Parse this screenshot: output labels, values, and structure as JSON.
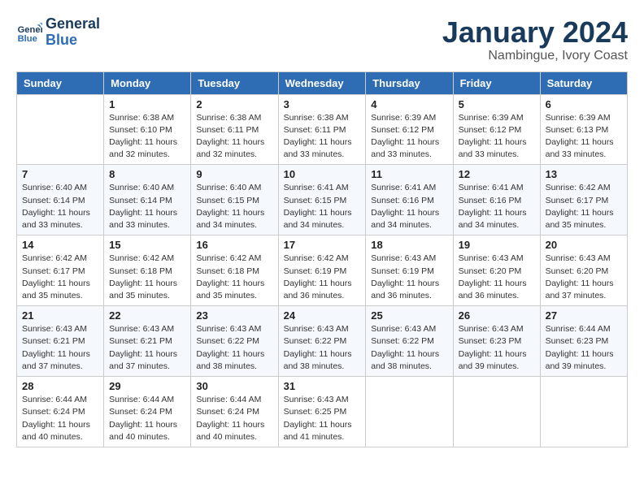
{
  "logo": {
    "line1": "General",
    "line2": "Blue"
  },
  "title": "January 2024",
  "subtitle": "Nambingue, Ivory Coast",
  "days_of_week": [
    "Sunday",
    "Monday",
    "Tuesday",
    "Wednesday",
    "Thursday",
    "Friday",
    "Saturday"
  ],
  "weeks": [
    [
      {
        "day": "",
        "empty": true
      },
      {
        "day": "1",
        "sunrise": "6:38 AM",
        "sunset": "6:10 PM",
        "daylight": "11 hours and 32 minutes."
      },
      {
        "day": "2",
        "sunrise": "6:38 AM",
        "sunset": "6:11 PM",
        "daylight": "11 hours and 32 minutes."
      },
      {
        "day": "3",
        "sunrise": "6:38 AM",
        "sunset": "6:11 PM",
        "daylight": "11 hours and 33 minutes."
      },
      {
        "day": "4",
        "sunrise": "6:39 AM",
        "sunset": "6:12 PM",
        "daylight": "11 hours and 33 minutes."
      },
      {
        "day": "5",
        "sunrise": "6:39 AM",
        "sunset": "6:12 PM",
        "daylight": "11 hours and 33 minutes."
      },
      {
        "day": "6",
        "sunrise": "6:39 AM",
        "sunset": "6:13 PM",
        "daylight": "11 hours and 33 minutes."
      }
    ],
    [
      {
        "day": "7",
        "sunrise": "6:40 AM",
        "sunset": "6:14 PM",
        "daylight": "11 hours and 33 minutes."
      },
      {
        "day": "8",
        "sunrise": "6:40 AM",
        "sunset": "6:14 PM",
        "daylight": "11 hours and 33 minutes."
      },
      {
        "day": "9",
        "sunrise": "6:40 AM",
        "sunset": "6:15 PM",
        "daylight": "11 hours and 34 minutes."
      },
      {
        "day": "10",
        "sunrise": "6:41 AM",
        "sunset": "6:15 PM",
        "daylight": "11 hours and 34 minutes."
      },
      {
        "day": "11",
        "sunrise": "6:41 AM",
        "sunset": "6:16 PM",
        "daylight": "11 hours and 34 minutes."
      },
      {
        "day": "12",
        "sunrise": "6:41 AM",
        "sunset": "6:16 PM",
        "daylight": "11 hours and 34 minutes."
      },
      {
        "day": "13",
        "sunrise": "6:42 AM",
        "sunset": "6:17 PM",
        "daylight": "11 hours and 35 minutes."
      }
    ],
    [
      {
        "day": "14",
        "sunrise": "6:42 AM",
        "sunset": "6:17 PM",
        "daylight": "11 hours and 35 minutes."
      },
      {
        "day": "15",
        "sunrise": "6:42 AM",
        "sunset": "6:18 PM",
        "daylight": "11 hours and 35 minutes."
      },
      {
        "day": "16",
        "sunrise": "6:42 AM",
        "sunset": "6:18 PM",
        "daylight": "11 hours and 35 minutes."
      },
      {
        "day": "17",
        "sunrise": "6:42 AM",
        "sunset": "6:19 PM",
        "daylight": "11 hours and 36 minutes."
      },
      {
        "day": "18",
        "sunrise": "6:43 AM",
        "sunset": "6:19 PM",
        "daylight": "11 hours and 36 minutes."
      },
      {
        "day": "19",
        "sunrise": "6:43 AM",
        "sunset": "6:20 PM",
        "daylight": "11 hours and 36 minutes."
      },
      {
        "day": "20",
        "sunrise": "6:43 AM",
        "sunset": "6:20 PM",
        "daylight": "11 hours and 37 minutes."
      }
    ],
    [
      {
        "day": "21",
        "sunrise": "6:43 AM",
        "sunset": "6:21 PM",
        "daylight": "11 hours and 37 minutes."
      },
      {
        "day": "22",
        "sunrise": "6:43 AM",
        "sunset": "6:21 PM",
        "daylight": "11 hours and 37 minutes."
      },
      {
        "day": "23",
        "sunrise": "6:43 AM",
        "sunset": "6:22 PM",
        "daylight": "11 hours and 38 minutes."
      },
      {
        "day": "24",
        "sunrise": "6:43 AM",
        "sunset": "6:22 PM",
        "daylight": "11 hours and 38 minutes."
      },
      {
        "day": "25",
        "sunrise": "6:43 AM",
        "sunset": "6:22 PM",
        "daylight": "11 hours and 38 minutes."
      },
      {
        "day": "26",
        "sunrise": "6:43 AM",
        "sunset": "6:23 PM",
        "daylight": "11 hours and 39 minutes."
      },
      {
        "day": "27",
        "sunrise": "6:44 AM",
        "sunset": "6:23 PM",
        "daylight": "11 hours and 39 minutes."
      }
    ],
    [
      {
        "day": "28",
        "sunrise": "6:44 AM",
        "sunset": "6:24 PM",
        "daylight": "11 hours and 40 minutes."
      },
      {
        "day": "29",
        "sunrise": "6:44 AM",
        "sunset": "6:24 PM",
        "daylight": "11 hours and 40 minutes."
      },
      {
        "day": "30",
        "sunrise": "6:44 AM",
        "sunset": "6:24 PM",
        "daylight": "11 hours and 40 minutes."
      },
      {
        "day": "31",
        "sunrise": "6:43 AM",
        "sunset": "6:25 PM",
        "daylight": "11 hours and 41 minutes."
      },
      {
        "day": "",
        "empty": true
      },
      {
        "day": "",
        "empty": true
      },
      {
        "day": "",
        "empty": true
      }
    ]
  ]
}
